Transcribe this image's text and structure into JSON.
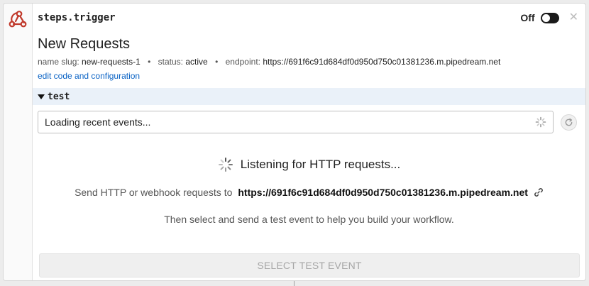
{
  "step": {
    "name": "steps.trigger",
    "title": "New Requests",
    "icon": "webhook-icon",
    "toggle_label": "Off",
    "toggle_state": "off"
  },
  "meta": {
    "slug_label": "name slug:",
    "slug_value": "new-requests-1",
    "status_label": "status:",
    "status_value": "active",
    "endpoint_label": "endpoint:",
    "endpoint_value": "https://691f6c91d684df0d950d750c01381236.m.pipedream.net",
    "separator": "•"
  },
  "edit_link": "edit code and configuration",
  "test_section": {
    "title": "test",
    "events_select": "Loading recent events...",
    "listening": "Listening for HTTP requests...",
    "send_prefix": "Send HTTP or webhook requests to",
    "send_url": "https://691f6c91d684df0d950d750c01381236.m.pipedream.net",
    "then_text": "Then select and send a test event to help you build your workflow.",
    "select_button": "SELECT TEST EVENT"
  },
  "colors": {
    "link": "#0b63c5",
    "section_bg": "#eaf1f9",
    "logo": "#c0392b"
  }
}
